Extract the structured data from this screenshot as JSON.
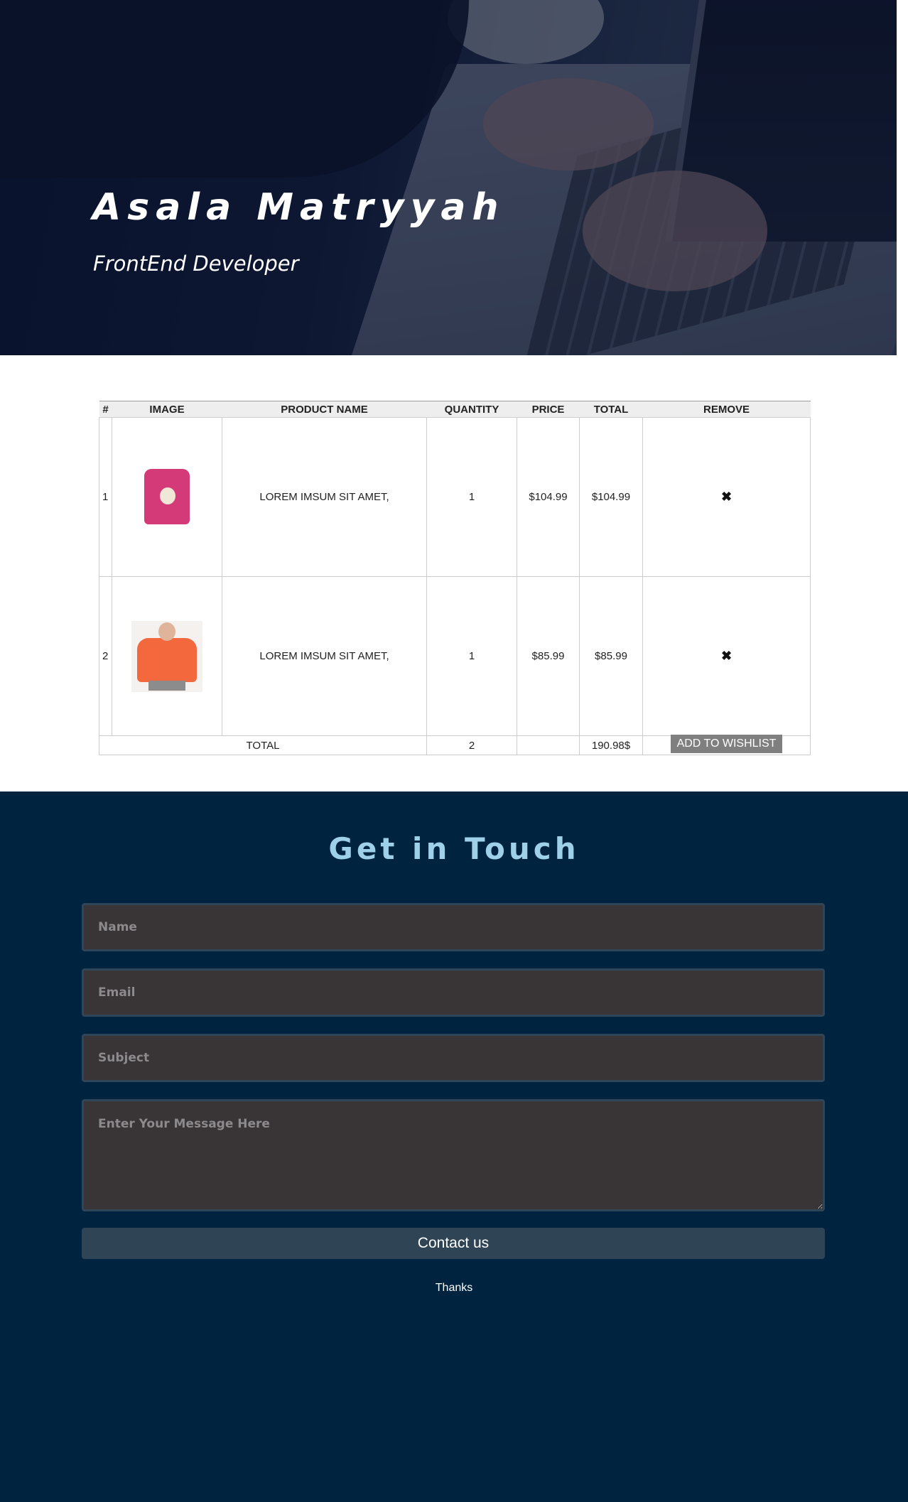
{
  "hero": {
    "name": "Asala  Matryyah",
    "role": "FrontEnd Developer"
  },
  "cart": {
    "headers": [
      "#",
      "IMAGE",
      "PRODUCT NAME",
      "QUANTITY",
      "PRICE",
      "TOTAL",
      "REMOVE"
    ],
    "rows": [
      {
        "index": "1",
        "image": "pink-tshirt",
        "name": "LOREM IMSUM SIT AMET,",
        "quantity": "1",
        "price": "$104.99",
        "total": "$104.99",
        "remove": "✖"
      },
      {
        "index": "2",
        "image": "orange-sweatshirt",
        "name": "LOREM IMSUM SIT AMET,",
        "quantity": "1",
        "price": "$85.99",
        "total": "$85.99",
        "remove": "✖"
      }
    ],
    "footer": {
      "label": "TOTAL",
      "quantity": "2",
      "total": "190.98$",
      "wishlist_label": "ADD TO WISHLIST"
    }
  },
  "contact": {
    "title": "Get in Touch",
    "name_placeholder": "Name",
    "email_placeholder": "Email",
    "subject_placeholder": "Subject",
    "message_placeholder": "Enter Your Message Here",
    "submit_label": "Contact us",
    "thanks": "Thanks"
  }
}
